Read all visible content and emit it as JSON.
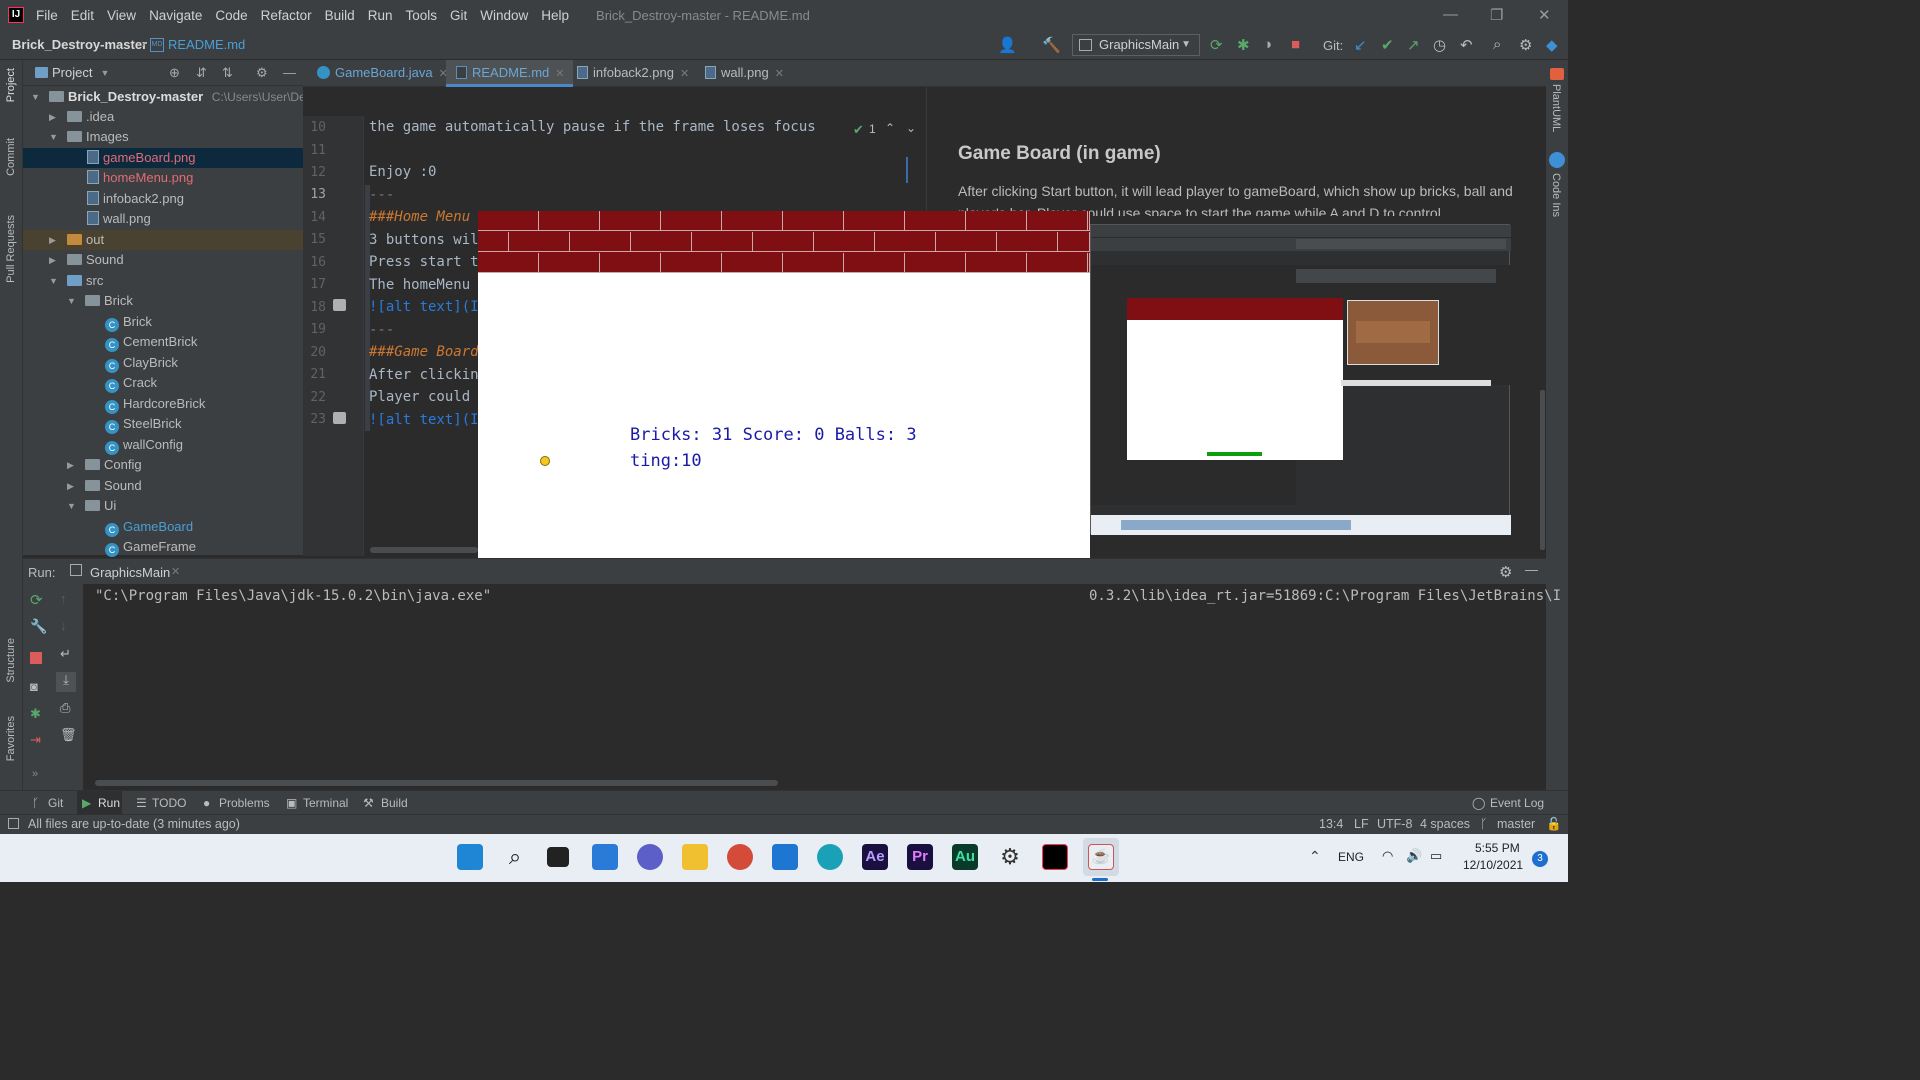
{
  "app": {
    "logo": "IJ",
    "window_title": "Brick_Destroy-master - README.md"
  },
  "menu": [
    "File",
    "Edit",
    "View",
    "Navigate",
    "Code",
    "Refactor",
    "Build",
    "Run",
    "Tools",
    "Git",
    "Window",
    "Help"
  ],
  "breadcrumb": {
    "project": "Brick_Destroy-master",
    "file": "README.md"
  },
  "toolbar": {
    "run_config": "GraphicsMain",
    "git_label": "Git:"
  },
  "project_panel": {
    "title": "Project",
    "root": "Brick_Destroy-master",
    "root_path": "C:\\Users\\User\\Deskt",
    "items": [
      {
        "label": ".idea"
      },
      {
        "label": "Images"
      },
      {
        "label": "gameBoard.png"
      },
      {
        "label": "homeMenu.png"
      },
      {
        "label": "infoback2.png"
      },
      {
        "label": "wall.png"
      },
      {
        "label": "out"
      },
      {
        "label": "Sound"
      },
      {
        "label": "src"
      },
      {
        "label": "Brick"
      },
      {
        "label": "Brick"
      },
      {
        "label": "CementBrick"
      },
      {
        "label": "ClayBrick"
      },
      {
        "label": "Crack"
      },
      {
        "label": "HardcoreBrick"
      },
      {
        "label": "SteelBrick"
      },
      {
        "label": "wallConfig"
      },
      {
        "label": "Config"
      },
      {
        "label": "Sound"
      },
      {
        "label": "Ui"
      },
      {
        "label": "GameBoard"
      },
      {
        "label": "GameFrame"
      }
    ]
  },
  "tabs": [
    "GameBoard.java",
    "README.md",
    "infoback2.png",
    "wall.png"
  ],
  "editor": {
    "line_numbers": [
      "10",
      "11",
      "12",
      "13",
      "14",
      "15",
      "16",
      "17",
      "18",
      "19",
      "20",
      "21",
      "22",
      "23"
    ],
    "lines": [
      "the game automatically pause if the frame loses focus",
      "",
      "Enjoy :0",
      "---",
      "###Home Menu",
      "3 buttons wil",
      "Press start t",
      "The homeMenu w",
      "![alt text](In",
      "---",
      "###Game Board",
      "After clickin",
      "Player could ",
      "![alt text](In"
    ],
    "inspection_count": "1"
  },
  "preview": {
    "heading": "Game Board (in game)",
    "paragraph": "After clicking Start button, it will lead player to gameBoard, which show up bricks, ball and player's bar. Player could use space to start the game while A and D to control."
  },
  "game": {
    "status_line1": "Bricks: 31 Score: 0 Balls: 3",
    "status_line2": "ting:10"
  },
  "run": {
    "label": "Run:",
    "tab": "GraphicsMain",
    "console_left": "\"C:\\Program Files\\Java\\jdk-15.0.2\\bin\\java.exe\"",
    "console_right": "0.3.2\\lib\\idea_rt.jar=51869:C:\\Program Files\\JetBrains\\I"
  },
  "tool_windows": [
    "Git",
    "Run",
    "TODO",
    "Problems",
    "Terminal",
    "Build",
    "Event Log"
  ],
  "left_strip": [
    "Project",
    "Commit",
    "Pull Requests",
    "Structure",
    "Favorites"
  ],
  "right_strip": [
    "PlantUML",
    "Code Ins"
  ],
  "status": {
    "message": "All files are up-to-date (3 minutes ago)",
    "position": "13:4",
    "line_sep": "LF",
    "encoding": "UTF-8",
    "indent": "4 spaces",
    "branch": "master"
  },
  "taskbar": {
    "language": "ENG",
    "time": "5:55 PM",
    "date": "12/10/2021",
    "notifications": "3",
    "apps": [
      "Ae",
      "Pr",
      "Au"
    ]
  },
  "colors": {
    "brick": "#800f14",
    "paddle": "#0c9e0c",
    "ball": "#f2c81e",
    "game_text": "#1a1aa8",
    "accent": "#4a88c7"
  }
}
